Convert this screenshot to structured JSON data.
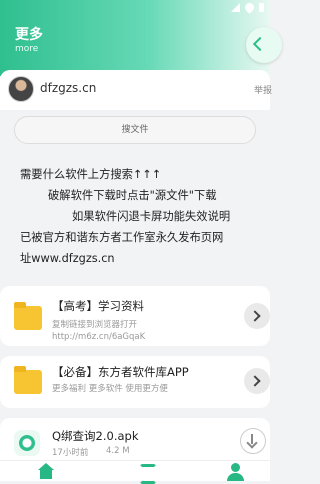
{
  "header": {
    "title": "更多",
    "subtitle": "more"
  },
  "user": {
    "name": "dfzgzs.cn",
    "action": "举报"
  },
  "search": {
    "label": "搜文件"
  },
  "notice": {
    "line1": "需要什么软件上方搜索↑↑↑",
    "line2": "破解软件下载时点击\"源文件\"下载",
    "line3": "如果软件闪退卡屏功能失效说明",
    "line4": "已被官方和谐东方者工作室永久发布页网",
    "line5": "址www.dfzgzs.cn"
  },
  "cards": [
    {
      "title": "【高考】学习资料",
      "sub1": "复制链接到浏览器打开",
      "sub2": "http://m6z.cn/6aGqaK"
    },
    {
      "title": "【必备】东方者软件库APP",
      "sub1": "更多福利 更多软件 使用更方便"
    }
  ],
  "app": {
    "name": "Q绑查询2.0.apk",
    "meta_time": "17小时前",
    "meta_size": "4.2 M"
  },
  "colors": {
    "accent": "#2fbf8f",
    "folder": "#f7c532"
  }
}
